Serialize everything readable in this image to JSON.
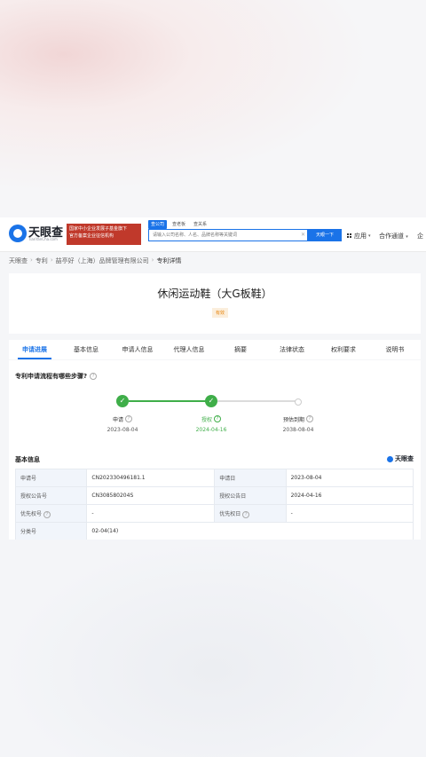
{
  "header": {
    "logo_title": "天眼查",
    "logo_sub": "TianYanCha.com",
    "promo_line1": "国家中小企业发展子基金旗下",
    "promo_line2": "官方备案企业征信机构",
    "search_tabs": [
      "查公司",
      "查老板",
      "查关系"
    ],
    "search_placeholder": "请输入公司名称、人名、品牌名称等关键词",
    "search_button": "天眼一下",
    "apps_label": "应用",
    "coop_label": "合作通道",
    "more_label": "企"
  },
  "breadcrumb": [
    "天眼查",
    "专利",
    "喆亭好（上海）品牌管理有限公司",
    "专利详情"
  ],
  "patent": {
    "title": "休闲运动鞋（大G板鞋）",
    "status": "有效"
  },
  "tabs": [
    "申请进展",
    "基本信息",
    "申请人信息",
    "代理人信息",
    "摘要",
    "法律状态",
    "权利要求",
    "说明书"
  ],
  "progress": {
    "question": "专利申请流程有哪些步骤?",
    "steps": [
      {
        "label": "申请",
        "date": "2023-08-04",
        "state": "done"
      },
      {
        "label": "授权",
        "date": "2024-04-16",
        "state": "done"
      },
      {
        "label": "预估到期",
        "date": "2038-08-04",
        "state": "pending"
      }
    ]
  },
  "basic": {
    "title": "基本信息",
    "brand": "天眼查",
    "rows": [
      {
        "k1": "申请号",
        "v1": "CN202330496181.1",
        "k2": "申请日",
        "v2": "2023-08-04"
      },
      {
        "k1": "授权公告号",
        "v1": "CN308580204S",
        "k2": "授权公告日",
        "v2": "2024-04-16"
      },
      {
        "k1": "优先权号",
        "v1": "-",
        "k2": "优先权日",
        "v2": "-"
      },
      {
        "k1": "分类号",
        "v1": "02-04(14)"
      }
    ]
  },
  "colors": {
    "accent": "#1a73e8",
    "success": "#3fae49",
    "status_bg": "#fbeedc",
    "status_text": "#e8850c"
  }
}
